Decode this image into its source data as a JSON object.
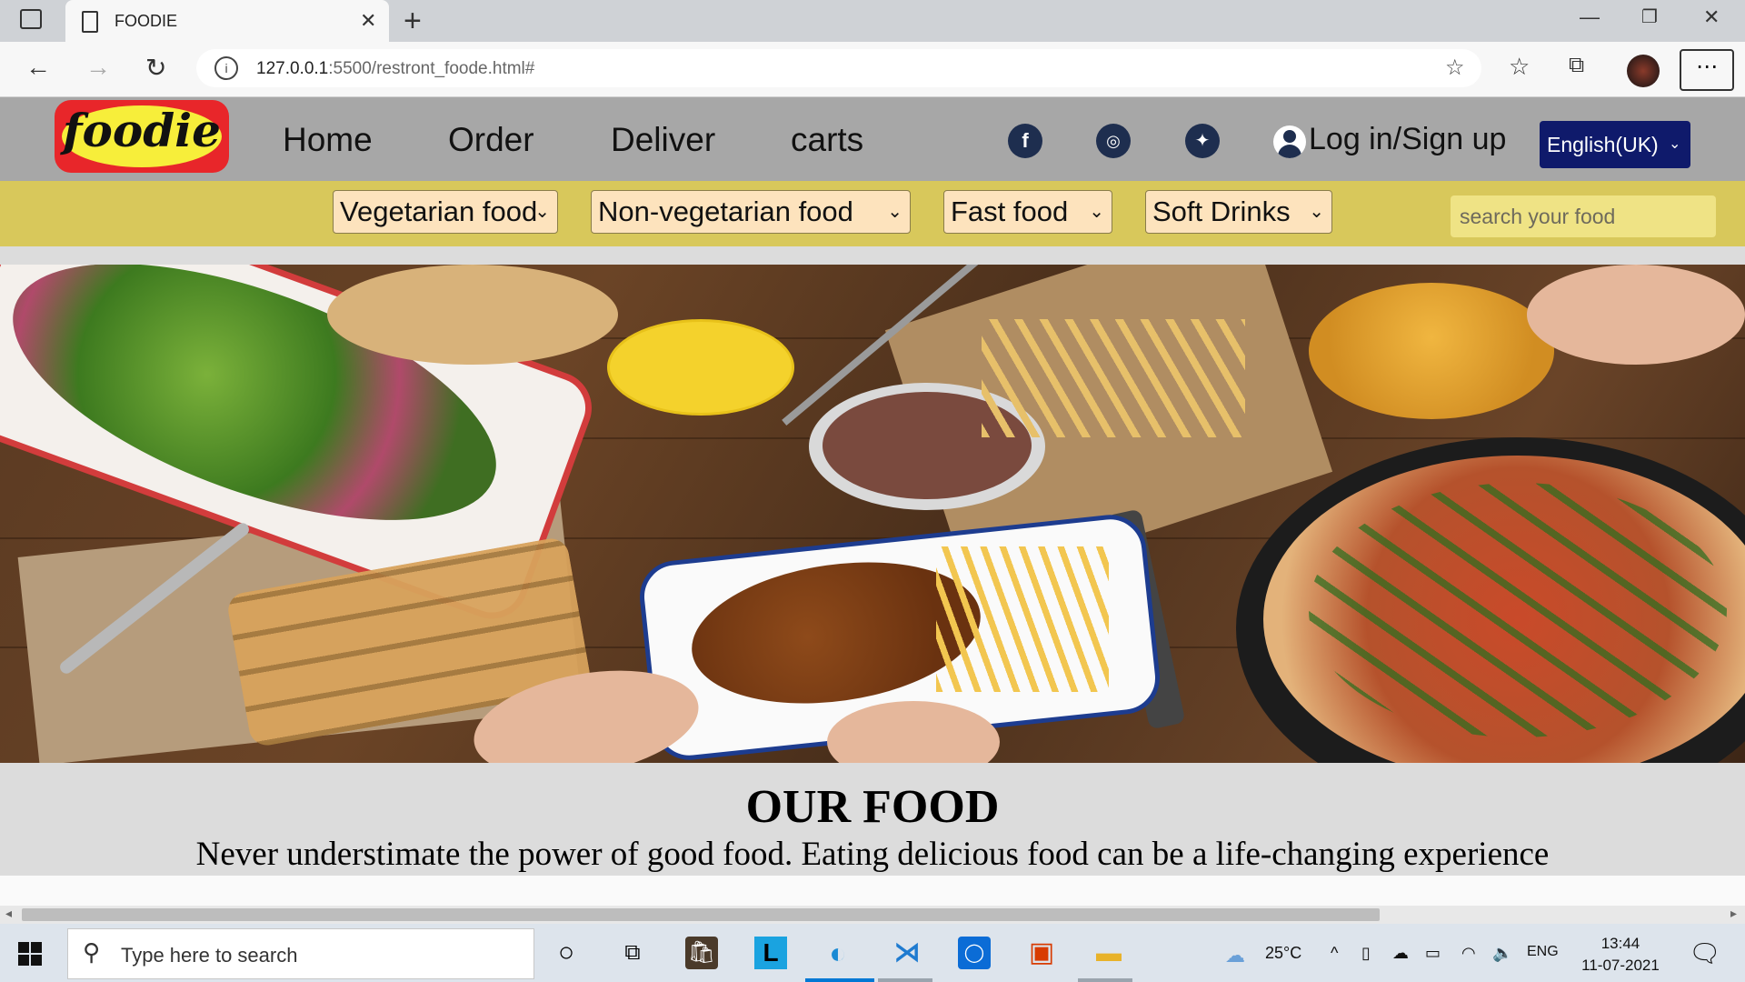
{
  "browser": {
    "tab_title": "FOODIE",
    "url_host": "127.0.0.1",
    "url_rest": ":5500/restront_foode.html#"
  },
  "site": {
    "logo_text": "foodie",
    "nav": [
      "Home",
      "Order",
      "Deliver",
      "carts"
    ],
    "social_icons": [
      "facebook-icon",
      "instagram-icon",
      "twitter-icon"
    ],
    "login_label": "Log in/Sign up",
    "language_selected": "English(UK)",
    "categories": [
      "Vegetarian food",
      "Non-vegetarian food",
      "Fast food",
      "Soft Drinks"
    ],
    "search_placeholder": "search your food",
    "heading": "OUR FOOD",
    "tagline": "Never understimate the power of good food. Eating delicious food can be a life-changing experience"
  },
  "taskbar": {
    "search_placeholder": "Type here to search",
    "weather": "25°C",
    "lang": "ENG",
    "time": "13:44",
    "date": "11-07-2021"
  },
  "colors": {
    "header_bg": "#a7a7a7",
    "category_bar_bg": "#d8c85b",
    "language_button_bg": "#0f1a6b",
    "category_select_bg": "#fde3bd"
  }
}
